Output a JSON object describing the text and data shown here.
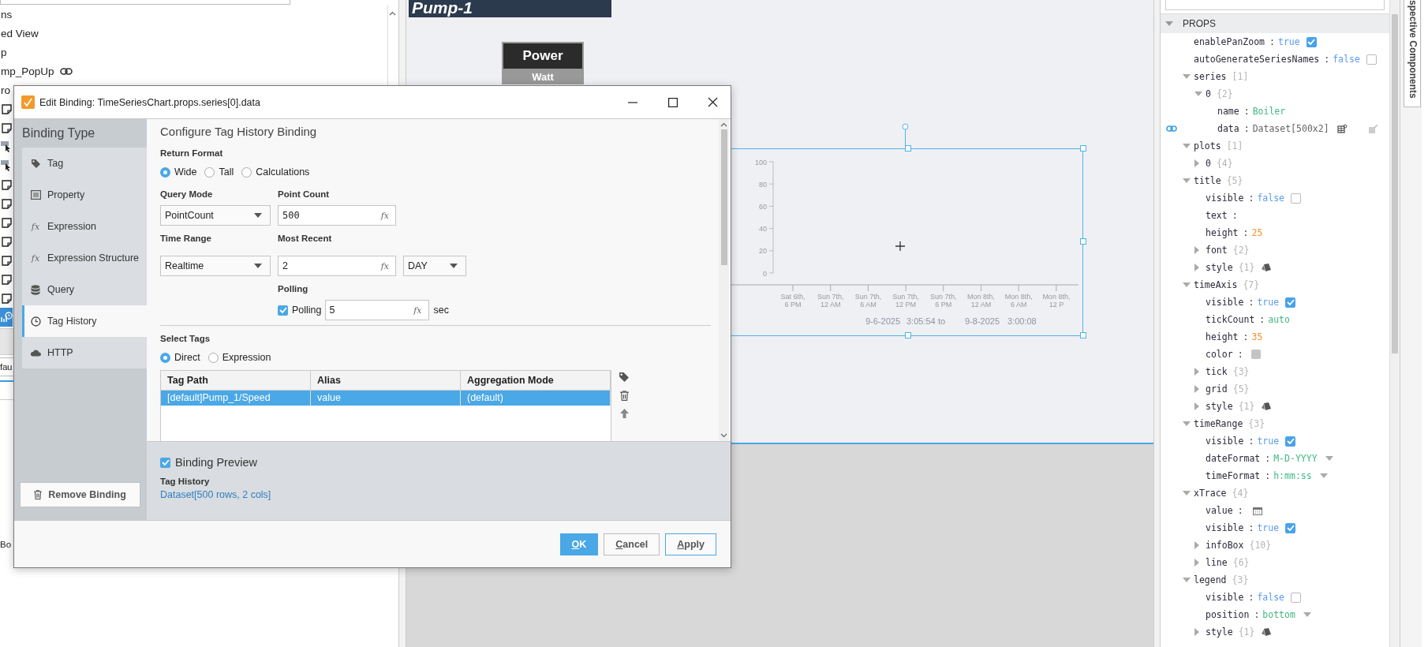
{
  "left_panel": {
    "tree_items": [
      {
        "label": "ns"
      },
      {
        "label": "ed View"
      },
      {
        "label": "p"
      },
      {
        "label": "mp_PopUp",
        "linked": true
      },
      {
        "label": "ro"
      }
    ],
    "edge_rows": [
      {
        "kind": "view",
        "selected": false
      },
      {
        "kind": "view",
        "selected": false
      },
      {
        "kind": "pointer",
        "selected": false
      },
      {
        "kind": "pointer",
        "selected": false
      },
      {
        "kind": "view",
        "selected": false
      },
      {
        "kind": "view",
        "selected": false
      },
      {
        "kind": "view",
        "selected": false
      },
      {
        "kind": "view",
        "selected": false
      },
      {
        "kind": "view",
        "selected": false
      },
      {
        "kind": "view",
        "selected": false
      },
      {
        "kind": "view",
        "selected": false
      },
      {
        "kind": "chart",
        "selected": true
      }
    ],
    "field_value": "fau",
    "footer_text": "Bo"
  },
  "canvas": {
    "banner": "Pump-1",
    "power_box": {
      "title": "Power",
      "unit": "Watt"
    },
    "chart": {
      "selected": true,
      "chart_data": {
        "type": "line",
        "ylim": [
          0,
          100
        ],
        "yticks": [
          0,
          20,
          40,
          60,
          80,
          100
        ],
        "categories": [
          "Sat 6th, 6 PM",
          "Sun 7th, 12 AM",
          "Sun 7th, 6 AM",
          "Sun 7th, 12 PM",
          "Sun 7th, 6 PM",
          "Mon 8th, 12 AM",
          "Mon 8th, 6 AM",
          "Mon 8th, 12 P"
        ]
      },
      "range_texts": [
        "9-6-2025",
        "3:05:54",
        "to",
        "9-8-2025",
        "3:00:08"
      ]
    }
  },
  "dialog": {
    "title": "Edit Binding: TimeSeriesChart.props.series[0].data",
    "sidebar": {
      "heading": "Binding Type",
      "items": [
        {
          "label": "Tag",
          "selected": false
        },
        {
          "label": "Property",
          "selected": false
        },
        {
          "label": "Expression",
          "icon_text": "fx",
          "selected": false
        },
        {
          "label": "Expression Structure",
          "icon_text": "fx",
          "selected": false
        },
        {
          "label": "Query",
          "selected": false
        },
        {
          "label": "Tag History",
          "selected": true
        },
        {
          "label": "HTTP",
          "selected": false
        }
      ],
      "remove_button": "Remove Binding"
    },
    "content": {
      "heading": "Configure Tag History Binding",
      "return_format": {
        "label": "Return Format",
        "options": [
          {
            "label": "Wide",
            "selected": true
          },
          {
            "label": "Tall",
            "selected": false
          },
          {
            "label": "Calculations",
            "selected": false
          }
        ]
      },
      "query_mode": {
        "label": "Query Mode",
        "value": "PointCount"
      },
      "point_count": {
        "label": "Point Count",
        "value": "500",
        "fx": "fx"
      },
      "time_range": {
        "label": "Time Range",
        "value": "Realtime"
      },
      "most_recent": {
        "label": "Most Recent",
        "value": "2",
        "fx": "fx",
        "unit": "DAY"
      },
      "polling": {
        "label": "Polling",
        "checkbox_label": "Polling",
        "checked": true,
        "value": "5",
        "fx": "fx",
        "unit": "sec"
      },
      "select_tags": {
        "label": "Select Tags",
        "options": [
          {
            "label": "Direct",
            "selected": true
          },
          {
            "label": "Expression",
            "selected": false
          }
        ]
      },
      "table": {
        "columns": [
          "Tag Path",
          "Alias",
          "Aggregation Mode"
        ],
        "rows": [
          {
            "cells": [
              "[default]Pump_1/Speed",
              "value",
              "(default)"
            ],
            "selected": true
          }
        ]
      }
    },
    "preview": {
      "label": "Binding Preview",
      "checked": true,
      "source": "Tag History",
      "value": "Dataset[500 rows, 2 cols]"
    },
    "buttons": [
      {
        "label": "OK",
        "kind": "primary"
      },
      {
        "label": "Cancel",
        "kind": "default"
      },
      {
        "label": "Apply",
        "kind": "outlined"
      }
    ]
  },
  "props_panel": {
    "header": "PROPS",
    "expanded": true,
    "side_tab": "spective Components",
    "tree": [
      {
        "key": "enablePanZoom",
        "sep": ":",
        "kind": "boolean",
        "value": "true",
        "checked": true
      },
      {
        "key": "autoGenerateSeriesNames",
        "sep": ":",
        "kind": "boolean",
        "value": "false",
        "checked": false
      },
      {
        "key": "series",
        "count": "[1]",
        "expanded": true,
        "children": [
          {
            "key": "0",
            "count": "{2}",
            "expanded": true,
            "children": [
              {
                "key": "name",
                "sep": ":",
                "kind": "string",
                "value": "Boiler"
              },
              {
                "key": "data",
                "sep": ":",
                "kind": "dataset",
                "value": "Dataset[500x2]",
                "bound": true
              }
            ]
          }
        ]
      },
      {
        "key": "plots",
        "count": "[1]",
        "expanded": true,
        "children": [
          {
            "key": "0",
            "count": "{4}",
            "expanded": false
          }
        ]
      },
      {
        "key": "title",
        "count": "{5}",
        "expanded": true,
        "children": [
          {
            "key": "visible",
            "sep": ":",
            "kind": "boolean",
            "value": "false",
            "checked": false
          },
          {
            "key": "text",
            "sep": ":",
            "kind": "empty"
          },
          {
            "key": "height",
            "sep": ":",
            "kind": "number",
            "value": "25"
          },
          {
            "key": "font",
            "count": "{2}",
            "expanded": false
          },
          {
            "key": "style",
            "count": "{1}",
            "expanded": false,
            "kind": "style"
          }
        ]
      },
      {
        "key": "timeAxis",
        "count": "{7}",
        "expanded": true,
        "children": [
          {
            "key": "visible",
            "sep": ":",
            "kind": "boolean",
            "value": "true",
            "checked": true
          },
          {
            "key": "tickCount",
            "sep": ":",
            "kind": "string",
            "value": "auto"
          },
          {
            "key": "height",
            "sep": ":",
            "kind": "number",
            "value": "35"
          },
          {
            "key": "color",
            "sep": ":",
            "kind": "color",
            "color": "#c4c4c4"
          },
          {
            "key": "tick",
            "count": "{3}",
            "expanded": false
          },
          {
            "key": "grid",
            "count": "{5}",
            "expanded": false
          },
          {
            "key": "style",
            "count": "{1}",
            "expanded": false,
            "kind": "style"
          }
        ]
      },
      {
        "key": "timeRange",
        "count": "{3}",
        "expanded": true,
        "children": [
          {
            "key": "visible",
            "sep": ":",
            "kind": "boolean",
            "value": "true",
            "checked": true
          },
          {
            "key": "dateFormat",
            "sep": ":",
            "kind": "enum",
            "value": "M-D-YYYY"
          },
          {
            "key": "timeFormat",
            "sep": ":",
            "kind": "enum",
            "value": "h:mm:ss"
          }
        ]
      },
      {
        "key": "xTrace",
        "count": "{4}",
        "expanded": true,
        "children": [
          {
            "key": "value",
            "sep": ":",
            "kind": "date"
          },
          {
            "key": "visible",
            "sep": ":",
            "kind": "boolean",
            "value": "true",
            "checked": true
          },
          {
            "key": "infoBox",
            "count": "{10}",
            "expanded": false
          },
          {
            "key": "line",
            "count": "{6}",
            "expanded": false
          }
        ]
      },
      {
        "key": "legend",
        "count": "{3}",
        "expanded": true,
        "children": [
          {
            "key": "visible",
            "sep": ":",
            "kind": "boolean",
            "value": "false",
            "checked": false
          },
          {
            "key": "position",
            "sep": ":",
            "kind": "enum",
            "value": "bottom"
          },
          {
            "key": "style",
            "count": "{1}",
            "expanded": false,
            "kind": "style"
          }
        ]
      }
    ]
  }
}
